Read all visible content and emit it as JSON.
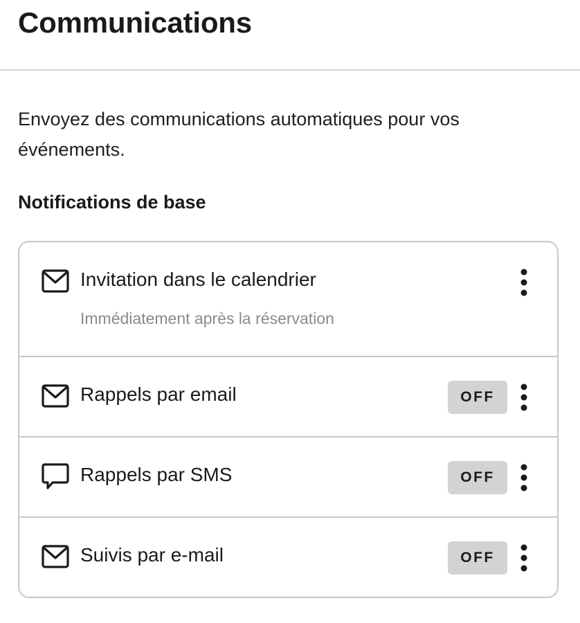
{
  "header": {
    "title": "Communications"
  },
  "description": "Envoyez des communications automatiques pour vos événements.",
  "section_title": "Notifications de base",
  "notifications": [
    {
      "icon": "mail-icon",
      "label": "Invitation dans le calendrier",
      "subtitle": "Immédiatement après la réservation"
    },
    {
      "icon": "mail-icon",
      "label": "Rappels par email",
      "toggle": "OFF"
    },
    {
      "icon": "chat-bubble-icon",
      "label": "Rappels par SMS",
      "toggle": "OFF"
    },
    {
      "icon": "mail-icon",
      "label": "Suivis par e-mail",
      "toggle": "OFF"
    }
  ],
  "colors": {
    "toggle_off_bg": "#d3d3d3",
    "subtitle": "#8a8a8a",
    "border": "#c8c8c8"
  }
}
